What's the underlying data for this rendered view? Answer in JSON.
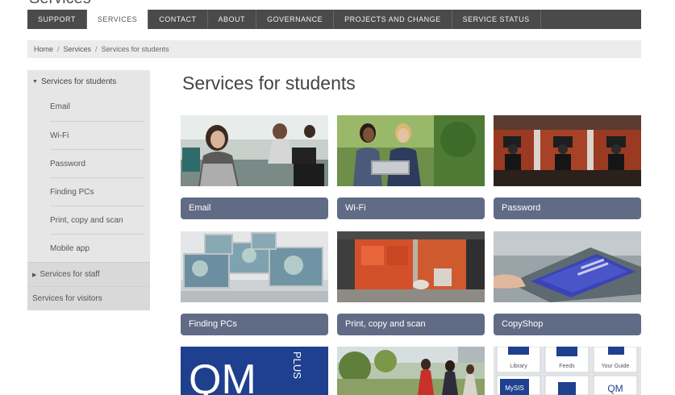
{
  "nav": {
    "items": [
      {
        "label": "SUPPORT",
        "active": false
      },
      {
        "label": "SERVICES",
        "active": true
      },
      {
        "label": "CONTACT",
        "active": false
      },
      {
        "label": "ABOUT",
        "active": false
      },
      {
        "label": "GOVERNANCE",
        "active": false
      },
      {
        "label": "PROJECTS AND CHANGE",
        "active": false
      },
      {
        "label": "SERVICE STATUS",
        "active": false
      }
    ]
  },
  "breadcrumb": {
    "home": "Home",
    "services": "Services",
    "current": "Services for students",
    "separator": "/"
  },
  "sidebar": {
    "open_section": "Services for students",
    "sub_items": [
      "Email",
      "Wi-Fi",
      "Password",
      "Finding PCs",
      "Print, copy and scan",
      "Mobile app"
    ],
    "closed_sections": [
      "Services for staff"
    ],
    "plain_sections": [
      "Services for visitors"
    ]
  },
  "page": {
    "title": "Services for students"
  },
  "tiles": [
    {
      "label": "Email",
      "icon": "woman-laptop-photo"
    },
    {
      "label": "Wi-Fi",
      "icon": "students-laptop-outdoors-photo"
    },
    {
      "label": "Password",
      "icon": "study-booths-photo"
    },
    {
      "label": "Finding PCs",
      "icon": "computer-lab-photo"
    },
    {
      "label": "Print, copy and scan",
      "icon": "print-room-photo"
    },
    {
      "label": "CopyShop",
      "icon": "copier-photo"
    },
    {
      "label": "",
      "icon": "qm-plus-logo"
    },
    {
      "label": "",
      "icon": "campus-students-photo"
    },
    {
      "label": "",
      "icon": "app-grid-photo"
    }
  ],
  "partial_tiles": {
    "qmplus": {
      "big": "QM",
      "side": "PLUS"
    },
    "app_grid": [
      "Library",
      "Feeds",
      "Your Guide",
      "MySIS",
      "",
      "QM"
    ]
  },
  "top_remnant": "Services",
  "colors": {
    "nav_bg": "#4a4a4a",
    "tile_label_bg": "#606b85",
    "sidebar_bg": "#e6e6e6",
    "qm_blue": "#1f3f8f"
  }
}
